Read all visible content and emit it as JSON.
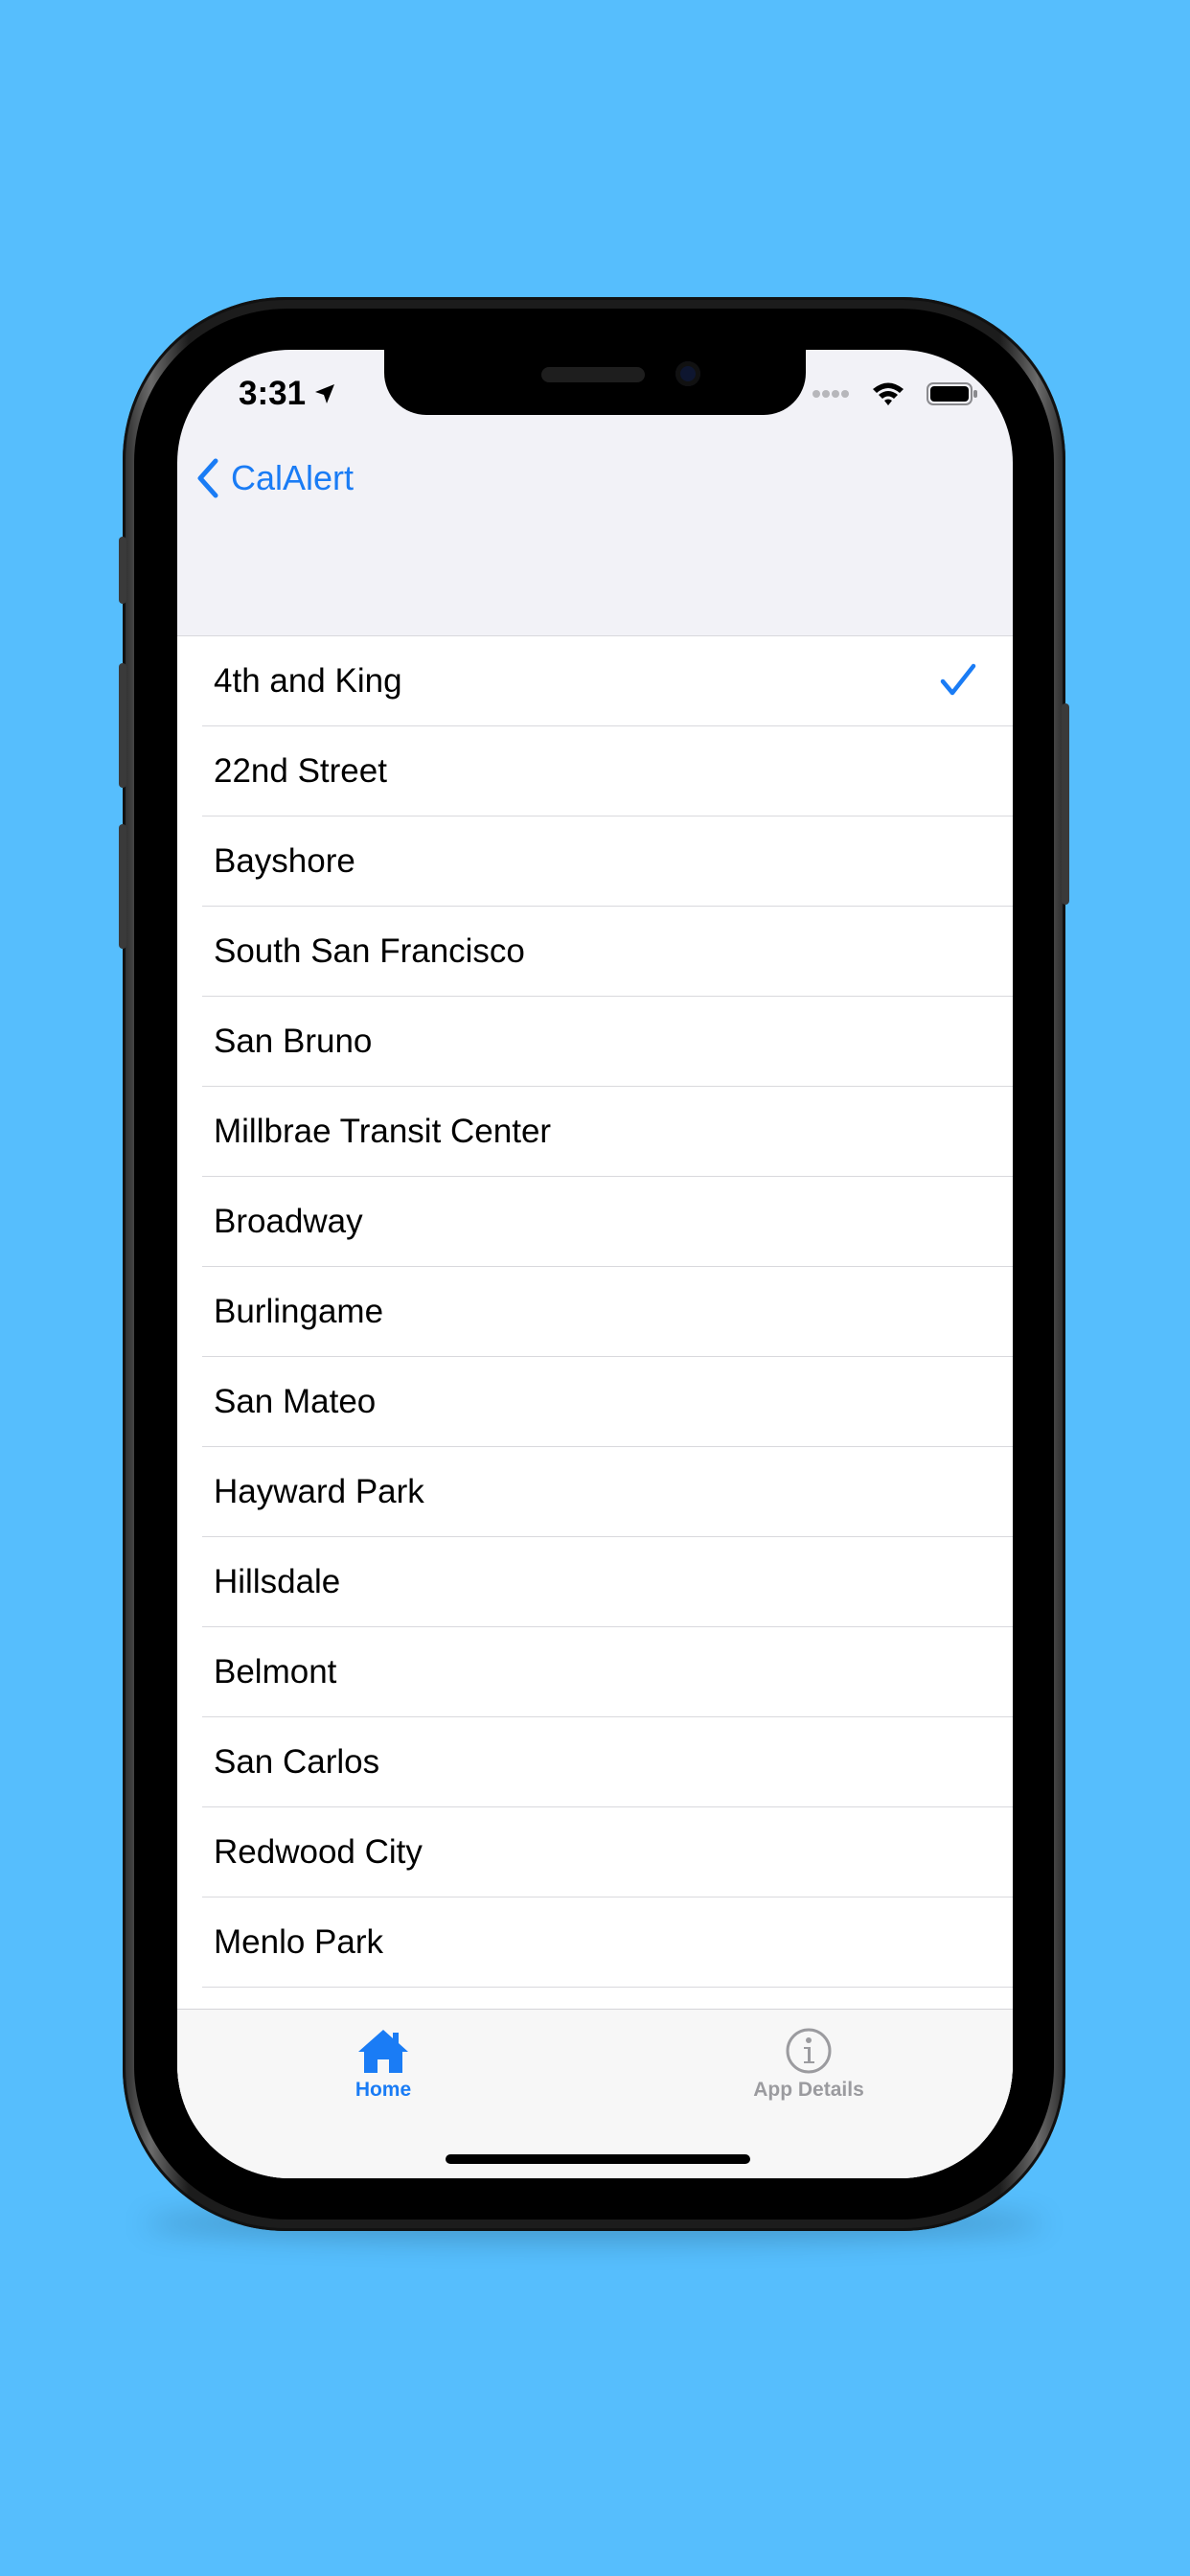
{
  "status_bar": {
    "time": "3:31",
    "location_icon": "location-arrow-icon",
    "signal_icon": "cellular-dots-icon",
    "wifi_icon": "wifi-icon",
    "battery_icon": "battery-full-icon"
  },
  "nav": {
    "back_label": "CalAlert",
    "back_icon": "chevron-left-icon"
  },
  "stations": [
    {
      "label": "4th and King",
      "selected": true
    },
    {
      "label": "22nd Street",
      "selected": false
    },
    {
      "label": "Bayshore",
      "selected": false
    },
    {
      "label": "South San Francisco",
      "selected": false
    },
    {
      "label": "San Bruno",
      "selected": false
    },
    {
      "label": "Millbrae Transit Center",
      "selected": false
    },
    {
      "label": "Broadway",
      "selected": false
    },
    {
      "label": "Burlingame",
      "selected": false
    },
    {
      "label": "San Mateo",
      "selected": false
    },
    {
      "label": "Hayward Park",
      "selected": false
    },
    {
      "label": "Hillsdale",
      "selected": false
    },
    {
      "label": "Belmont",
      "selected": false
    },
    {
      "label": "San Carlos",
      "selected": false
    },
    {
      "label": "Redwood City",
      "selected": false
    },
    {
      "label": "Menlo Park",
      "selected": false
    }
  ],
  "tabbar": {
    "home_label": "Home",
    "home_icon": "house-icon",
    "details_label": "App Details",
    "details_icon": "info-circle-icon"
  },
  "colors": {
    "background": "#56BEFD",
    "accent": "#1A7CF5",
    "inactive_tab": "#9b9b9f"
  }
}
